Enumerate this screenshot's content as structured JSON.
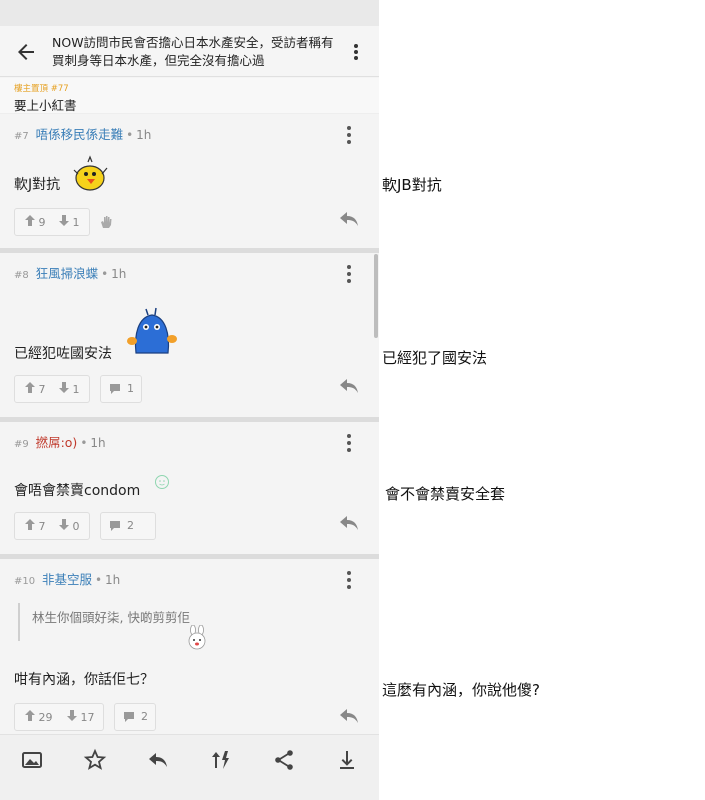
{
  "header": {
    "title": "NOW訪問市民會否擔心日本水產安全，受訪者稱有買刺身等日本水產，但完全沒有擔心過"
  },
  "quote_strip": {
    "label": "樓主置頂 #77",
    "text": "要上小紅書"
  },
  "posts": [
    {
      "number": "#7",
      "username": "唔係移民係走難",
      "time": "1h",
      "text": "軟J對抗",
      "upvotes": "9",
      "downvotes": "1"
    },
    {
      "number": "#8",
      "username": "狂風掃浪蝶",
      "time": "1h",
      "text": "已經犯咗國安法",
      "upvotes": "7",
      "downvotes": "1",
      "replies": "1"
    },
    {
      "number": "#9",
      "username": "撚屌:o)",
      "time": "1h",
      "text": "會唔會禁賣condom",
      "upvotes": "7",
      "downvotes": "0",
      "replies": "2"
    },
    {
      "number": "#10",
      "username": "非基空服",
      "time": "1h",
      "quote": "林生你個頭好柒, 快啲剪剪佢",
      "text": "咁有內涵，你話佢七？",
      "upvotes": "29",
      "downvotes": "17",
      "replies": "2"
    }
  ],
  "translations": [
    "軟JB對抗",
    "已經犯了國安法",
    "會不會禁賣安全套",
    "這麼有內涵，你說他傻?"
  ],
  "icons": {
    "back": "back-arrow-icon",
    "more": "more-vertical-icon",
    "upvote": "arrow-up-icon",
    "downvote": "arrow-down-icon",
    "reply": "reply-icon",
    "comment": "comment-icon",
    "bottom": [
      "image-icon",
      "star-icon",
      "reply-icon",
      "sort-icon",
      "share-icon",
      "download-icon"
    ]
  },
  "colors": {
    "username_male": "#3b7fb8",
    "username_female": "#c0392b",
    "pinned_label": "#e6a020",
    "background": "#f4f4f4"
  }
}
